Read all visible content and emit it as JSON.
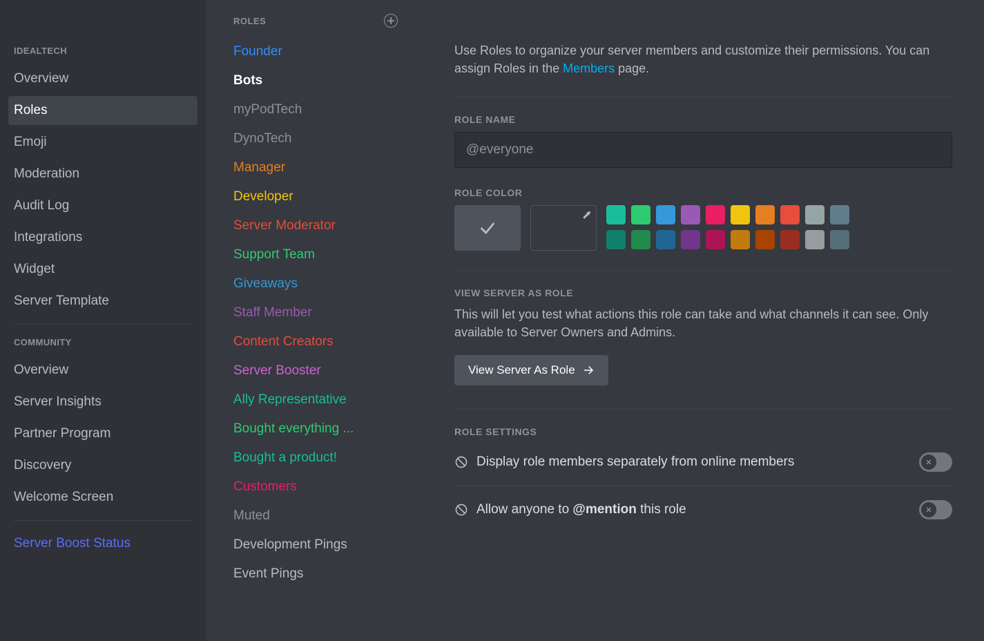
{
  "sidebar": {
    "section1_header": "IDEALTECH",
    "items1": [
      {
        "label": "Overview"
      },
      {
        "label": "Roles"
      },
      {
        "label": "Emoji"
      },
      {
        "label": "Moderation"
      },
      {
        "label": "Audit Log"
      },
      {
        "label": "Integrations"
      },
      {
        "label": "Widget"
      },
      {
        "label": "Server Template"
      }
    ],
    "section2_header": "COMMUNITY",
    "items2": [
      {
        "label": "Overview"
      },
      {
        "label": "Server Insights"
      },
      {
        "label": "Partner Program"
      },
      {
        "label": "Discovery"
      },
      {
        "label": "Welcome Screen"
      }
    ],
    "boost_label": "Server Boost Status"
  },
  "roles_list": {
    "header": "ROLES",
    "items": [
      {
        "label": "Founder",
        "color": "#2c8fff"
      },
      {
        "label": "Bots",
        "color": "#ffffff",
        "bold": true
      },
      {
        "label": "myPodTech",
        "color": "#8e9297"
      },
      {
        "label": "DynoTech",
        "color": "#8e9297"
      },
      {
        "label": "Manager",
        "color": "#e67e22"
      },
      {
        "label": "Developer",
        "color": "#f1c40f"
      },
      {
        "label": "Server Moderator",
        "color": "#e74c3c"
      },
      {
        "label": "Support Team",
        "color": "#2ecc71"
      },
      {
        "label": "Giveaways",
        "color": "#3498db"
      },
      {
        "label": "Staff Member",
        "color": "#9b59b6"
      },
      {
        "label": "Content Creators",
        "color": "#e74c3c"
      },
      {
        "label": "Server Booster",
        "color": "#d160d6"
      },
      {
        "label": "Ally Representative",
        "color": "#1abc9c"
      },
      {
        "label": "Bought everything ...",
        "color": "#2ecc71"
      },
      {
        "label": "Bought a product!",
        "color": "#1abc9c"
      },
      {
        "label": "Customers",
        "color": "#e91e63"
      },
      {
        "label": "Muted",
        "color": "#8e9297"
      },
      {
        "label": "Development Pings",
        "color": "#b9bbbe"
      },
      {
        "label": "Event Pings",
        "color": "#b9bbbe"
      }
    ]
  },
  "main": {
    "desc_part1": "Use Roles to organize your server members and customize their permissions. You can assign Roles in the ",
    "desc_link": "Members",
    "desc_part2": " page.",
    "role_name_label": "ROLE NAME",
    "role_name_value": "@everyone",
    "role_color_label": "ROLE COLOR",
    "colors_row1": [
      "#1abc9c",
      "#2ecc71",
      "#3498db",
      "#9b59b6",
      "#e91e63",
      "#f1c40f",
      "#e67e22",
      "#e74c3c",
      "#95a5a6",
      "#607d8b"
    ],
    "colors_row2": [
      "#11806a",
      "#1f8b4c",
      "#206694",
      "#71368a",
      "#ad1457",
      "#c27c0e",
      "#a84300",
      "#992d22",
      "#979c9f",
      "#546e7a"
    ],
    "view_as_label": "VIEW SERVER AS ROLE",
    "view_as_desc": "This will let you test what actions this role can take and what channels it can see. Only available to Server Owners and Admins.",
    "view_as_button": "View Server As Role",
    "role_settings_label": "ROLE SETTINGS",
    "setting1": "Display role members separately from online members",
    "setting2_before": "Allow anyone to ",
    "setting2_bold": "@mention",
    "setting2_after": " this role"
  }
}
